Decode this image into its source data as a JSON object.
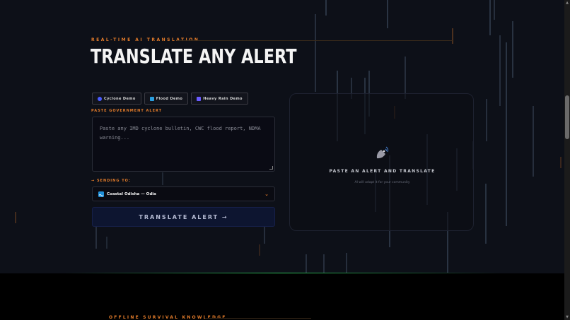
{
  "hero": {
    "eyebrow": "REAL-TIME AI TRANSLATION",
    "title": "TRANSLATE ANY ALERT"
  },
  "demos": [
    {
      "label": "Cyclone Demo",
      "icon": "cyclone-icon",
      "color": "#4a5cff"
    },
    {
      "label": "Flood Demo",
      "icon": "flood-icon",
      "color": "#2a9fe0"
    },
    {
      "label": "Heavy Rain Demo",
      "icon": "rain-icon",
      "color": "#6a5cff"
    }
  ],
  "form": {
    "paste_label": "PASTE GOVERNMENT ALERT",
    "alert_placeholder": "Paste any IMD cyclone bulletin, CWC flood report, NDMA warning...",
    "sending_label": "SENDING TO:",
    "sending_arrow": "→",
    "region_value": "Coastal Odisha — Odia",
    "region_icon": "wave-icon",
    "translate_label": "TRANSLATE ALERT →"
  },
  "output_panel": {
    "title": "PASTE AN ALERT AND TRANSLATE",
    "subtitle": "AI will adapt it for your community",
    "icon": "satellite-dish-icon"
  },
  "next_section": {
    "eyebrow": "OFFLINE SURVIVAL KNOWLEDGE"
  },
  "colors": {
    "accent": "#e07a2a",
    "background": "#0d1018",
    "button_bg": "#0d1530",
    "divider": "#2fbf5a"
  }
}
